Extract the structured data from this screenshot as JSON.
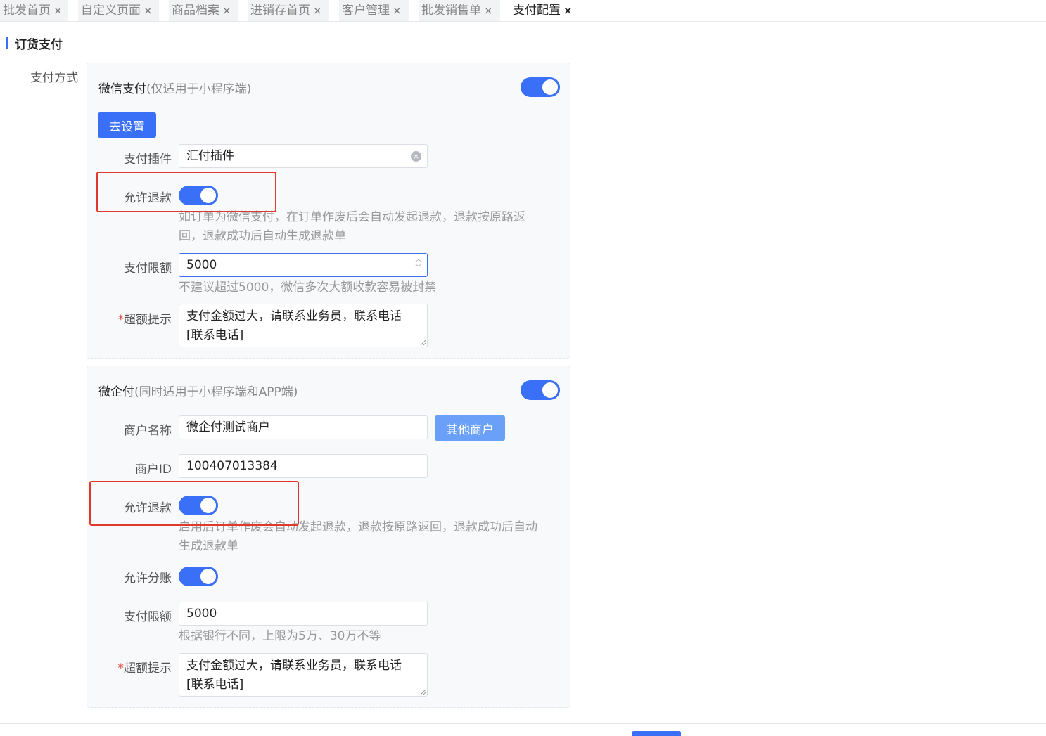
{
  "tabs": [
    {
      "label": "批发首页",
      "active": false
    },
    {
      "label": "自定义页面",
      "active": false
    },
    {
      "label": "商品档案",
      "active": false
    },
    {
      "label": "进销存首页",
      "active": false
    },
    {
      "label": "客户管理",
      "active": false
    },
    {
      "label": "批发销售单",
      "active": false
    },
    {
      "label": "支付配置",
      "active": true
    }
  ],
  "close_glyph": "×",
  "section": {
    "title": "订货支付"
  },
  "payment_method_label": "支付方式",
  "wechat": {
    "title": "微信支付",
    "subtitle": "(仅适用于小程序端)",
    "enabled": true,
    "setup_button": "去设置",
    "plugin_label": "支付插件",
    "plugin_value": "汇付插件",
    "refund_label": "允许退款",
    "refund_enabled": true,
    "refund_hint_line1": "如订单为微信支付，在订单作废后会自动发起退款，退款按原路返",
    "refund_hint_line2": "回，退款成功后自动生成退款单",
    "limit_label": "支付限额",
    "limit_value": "5000",
    "limit_hint": "不建议超过5000，微信多次大额收款容易被封禁",
    "over_label": "超额提示",
    "over_required": "*",
    "over_line1": "支付金额过大，请联系业务员，联系电话",
    "over_line2": "[联系电话]"
  },
  "qipay": {
    "title": "微企付",
    "subtitle": "(同时适用于小程序端和APP端)",
    "enabled": true,
    "merchant_name_label": "商户名称",
    "merchant_name_value": "微企付测试商户",
    "other_merchant_button": "其他商户",
    "merchant_id_label": "商户ID",
    "merchant_id_value": "100407013384",
    "refund_label": "允许退款",
    "refund_enabled": true,
    "refund_hint_line1": "启用后订单作废会自动发起退款，退款按原路返回，退款成功后自动",
    "refund_hint_line2": "生成退款单",
    "split_label": "允许分账",
    "split_enabled": true,
    "limit_label": "支付限额",
    "limit_value": "5000",
    "limit_hint": "根据银行不同，上限为5万、30万不等",
    "over_label": "超额提示",
    "over_required": "*",
    "over_line1": "支付金额过大，请联系业务员，联系电话",
    "over_line2": "[联系电话]"
  },
  "colors": {
    "accent": "#3a6ff7",
    "highlight": "#e0392b",
    "required": "#e8433b"
  }
}
